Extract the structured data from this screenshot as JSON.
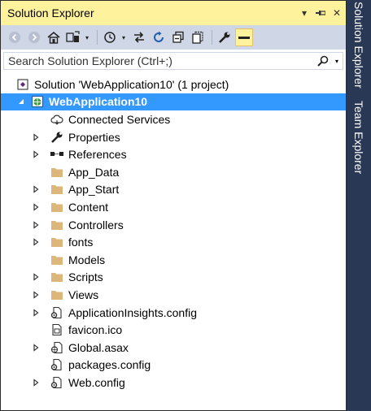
{
  "window": {
    "title": "Solution Explorer",
    "pin_glyph": "⊣",
    "dropdown_glyph": "▾",
    "close_glyph": "✕"
  },
  "toolbar": {
    "buttons": [
      "back-icon",
      "forward-icon",
      "home-icon",
      "switch-views-icon",
      "pending-changes-icon",
      "sync-icon",
      "refresh-icon",
      "collapse-all-icon",
      "show-all-files-icon",
      "properties-icon",
      "preview-icon"
    ]
  },
  "search": {
    "placeholder": "Search Solution Explorer (Ctrl+;)"
  },
  "tree": {
    "solution": "Solution 'WebApplication10' (1 project)",
    "project": "WebApplication10",
    "items": [
      {
        "label": "Connected Services",
        "expandable": false,
        "icon": "cloud-icon"
      },
      {
        "label": "Properties",
        "expandable": true,
        "icon": "wrench-icon"
      },
      {
        "label": "References",
        "expandable": true,
        "icon": "references-icon"
      },
      {
        "label": "App_Data",
        "expandable": false,
        "icon": "folder-icon"
      },
      {
        "label": "App_Start",
        "expandable": true,
        "icon": "folder-icon"
      },
      {
        "label": "Content",
        "expandable": true,
        "icon": "folder-icon"
      },
      {
        "label": "Controllers",
        "expandable": true,
        "icon": "folder-icon"
      },
      {
        "label": "fonts",
        "expandable": true,
        "icon": "folder-icon"
      },
      {
        "label": "Models",
        "expandable": false,
        "icon": "folder-icon"
      },
      {
        "label": "Scripts",
        "expandable": true,
        "icon": "folder-icon"
      },
      {
        "label": "Views",
        "expandable": true,
        "icon": "folder-icon"
      },
      {
        "label": "ApplicationInsights.config",
        "expandable": true,
        "icon": "config-file-icon"
      },
      {
        "label": "favicon.ico",
        "expandable": false,
        "icon": "image-file-icon"
      },
      {
        "label": "Global.asax",
        "expandable": true,
        "icon": "globe-file-icon"
      },
      {
        "label": "packages.config",
        "expandable": false,
        "icon": "config-file-icon"
      },
      {
        "label": "Web.config",
        "expandable": true,
        "icon": "config-file-icon"
      }
    ]
  },
  "side_tabs": [
    "Solution Explorer",
    "Team Explorer"
  ],
  "colors": {
    "title_bg": "#fff29d",
    "toolbar_bg": "#cfd6e5",
    "selection": "#3399ff",
    "side_bg": "#293955",
    "folder": "#dcb67a"
  }
}
